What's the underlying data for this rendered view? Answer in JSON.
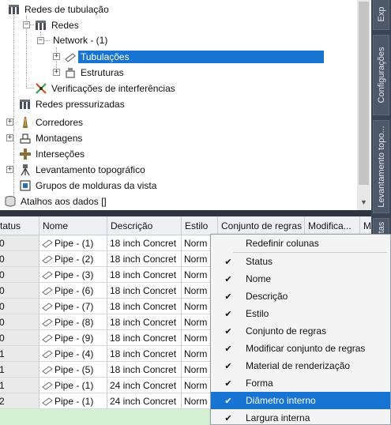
{
  "tree": {
    "items": [
      {
        "label": "Redes de tubulação",
        "icon": "pipe-network-icon"
      },
      {
        "label": "Redes",
        "icon": "pipe-network-icon"
      },
      {
        "label": "Network - (1)",
        "icon": "none"
      },
      {
        "label": "Tubulações",
        "icon": "pipe-icon"
      },
      {
        "label": "Estruturas",
        "icon": "structure-icon"
      },
      {
        "label": "Verificações de interferências",
        "icon": "interference-check-icon"
      },
      {
        "label": "Redes pressurizadas",
        "icon": "pressure-network-icon"
      },
      {
        "label": "Corredores",
        "icon": "corridor-icon"
      },
      {
        "label": "Montagens",
        "icon": "assembly-icon"
      },
      {
        "label": "Interseções",
        "icon": "intersection-icon"
      },
      {
        "label": "Levantamento topográfico",
        "icon": "survey-icon"
      },
      {
        "label": "Grupos de molduras da vista",
        "icon": "view-frame-icon"
      },
      {
        "label": "Atalhos aos dados []",
        "icon": "data-shortcut-icon"
      }
    ]
  },
  "side_tabs": [
    "Exp",
    "Configurações",
    "Levantamento topo...",
    "tas"
  ],
  "grid": {
    "columns": [
      "tatus",
      "Nome",
      "Descrição",
      "Estilo",
      "Conjunto de regras",
      "Modifica...",
      "M"
    ],
    "rows": [
      {
        "status": "0",
        "name": "Pipe  - (1)",
        "desc": "18 inch Concret",
        "style": "Norm"
      },
      {
        "status": "0",
        "name": "Pipe  - (2)",
        "desc": "18 inch Concret",
        "style": "Norm"
      },
      {
        "status": "0",
        "name": "Pipe  - (3)",
        "desc": "18 inch Concret",
        "style": "Norm"
      },
      {
        "status": "0",
        "name": "Pipe  - (6)",
        "desc": "18 inch Concret",
        "style": "Norm"
      },
      {
        "status": "0",
        "name": "Pipe  - (7)",
        "desc": "18 inch Concret",
        "style": "Norm"
      },
      {
        "status": "0",
        "name": "Pipe  - (8)",
        "desc": "18 inch Concret",
        "style": "Norm"
      },
      {
        "status": "0",
        "name": "Pipe  - (9)",
        "desc": "18 inch Concret",
        "style": "Norm"
      },
      {
        "status": "1",
        "name": "Pipe  - (4)",
        "desc": "18 inch Concret",
        "style": "Norm"
      },
      {
        "status": "1",
        "name": "Pipe  - (5)",
        "desc": "18 inch Concret",
        "style": "Norm"
      },
      {
        "status": "1",
        "name": "Pipe  - (1)",
        "desc": "24 inch Concret",
        "style": "Norm"
      },
      {
        "status": "2",
        "name": "Pipe  - (1)",
        "desc": "24 inch Concret",
        "style": "Norm"
      }
    ]
  },
  "context_menu": {
    "items": [
      {
        "label": "Redefinir colunas",
        "checked": false
      },
      {
        "label": "Status",
        "checked": true
      },
      {
        "label": "Nome",
        "checked": true
      },
      {
        "label": "Descrição",
        "checked": true
      },
      {
        "label": "Estilo",
        "checked": true
      },
      {
        "label": "Conjunto de regras",
        "checked": true
      },
      {
        "label": "Modificar conjunto de regras",
        "checked": true
      },
      {
        "label": "Material de renderização",
        "checked": true
      },
      {
        "label": "Forma",
        "checked": true
      },
      {
        "label": "Diâmetro interno",
        "checked": true
      },
      {
        "label": "Largura interna",
        "checked": true
      }
    ],
    "highlighted": "Diâmetro interno",
    "check_glyph": "✔"
  },
  "colors": {
    "selection": "#1874d3",
    "rail": "#3b4453",
    "header_bg": "#eef0f3"
  }
}
